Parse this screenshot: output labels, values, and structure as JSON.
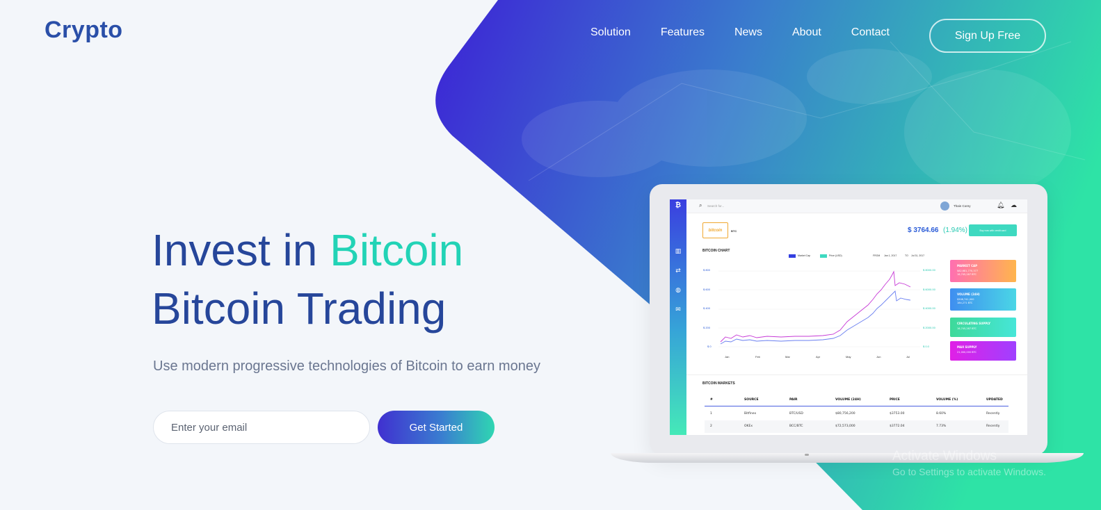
{
  "brand": {
    "logo": "Crypto"
  },
  "nav": {
    "items": [
      "Solution",
      "Features",
      "News",
      "About",
      "Contact"
    ],
    "signup_label": "Sign Up Free"
  },
  "hero": {
    "title_part1": "Invest in ",
    "title_accent": "Bitcoin",
    "title_line2": "Bitcoin Trading",
    "subtitle": "Use modern progressive technologies of Bitcoin to earn money",
    "email_placeholder": "Enter your email",
    "cta_label": "Get Started"
  },
  "dashboard": {
    "search_placeholder": "Search for...",
    "user_name": "Thain Corey",
    "coin_logo": "bitcoin",
    "coin_symbol": "BTC",
    "price": "$ 3764.66",
    "change": "(1.94%)",
    "buy_button": "Buy now with credit card",
    "chart_title": "BITCOIN CHART",
    "legend_market_cap": "Market Cap",
    "legend_price": "Price (USD)",
    "range_from_label": "FROM",
    "range_from": "Jan 1, 2017",
    "range_to_label": "TO",
    "range_to": "Jul 31, 2017",
    "y_left": [
      "$ 800",
      "$ 600",
      "$ 400",
      "$ 200",
      "$ 0"
    ],
    "y_right": [
      "$ 8000.00",
      "$ 6000.00",
      "$ 4000.00",
      "$ 2000.00",
      "$ 0.0"
    ],
    "x_labels": [
      "Jan",
      "Feb",
      "Mar",
      "Apr",
      "May",
      "Jun",
      "Jul"
    ],
    "cards": [
      {
        "title": "MARKET CAP",
        "line1": "$62,681,770,377",
        "line2": "16,745,287 BTC"
      },
      {
        "title": "VOLUME (24H)",
        "line1": "$508,741,000",
        "line2": "184,271 BTC"
      },
      {
        "title": "CIRCULATING SUPPLY",
        "line1": "16,745,287 BTC",
        "line2": ""
      },
      {
        "title": "MAX SUPPLY",
        "line1": "21,000,000 BTC",
        "line2": ""
      }
    ],
    "markets_title": "BITCOIN MARKETS",
    "table_headers": [
      "#",
      "SOURCE",
      "PAIR",
      "VOLUME (24H)",
      "PRICE",
      "VOLUME (%)",
      "UPDATED"
    ],
    "table_rows": [
      [
        "1",
        "Bitfinex",
        "BTC/USD",
        "$80,756,200",
        "$3753.00",
        "8.60%",
        "Recently"
      ],
      [
        "2",
        "OKEx",
        "BCC/BTC",
        "$72,573,000",
        "$3772.04",
        "7.73%",
        "Recently"
      ]
    ]
  },
  "watermark": {
    "line1": "Activate Windows",
    "line2": "Go to Settings to activate Windows."
  },
  "colors": {
    "primary": "#26469a",
    "accent": "#22d3b6",
    "gradient_start": "#4030d0",
    "gradient_end": "#2fd6b2"
  }
}
